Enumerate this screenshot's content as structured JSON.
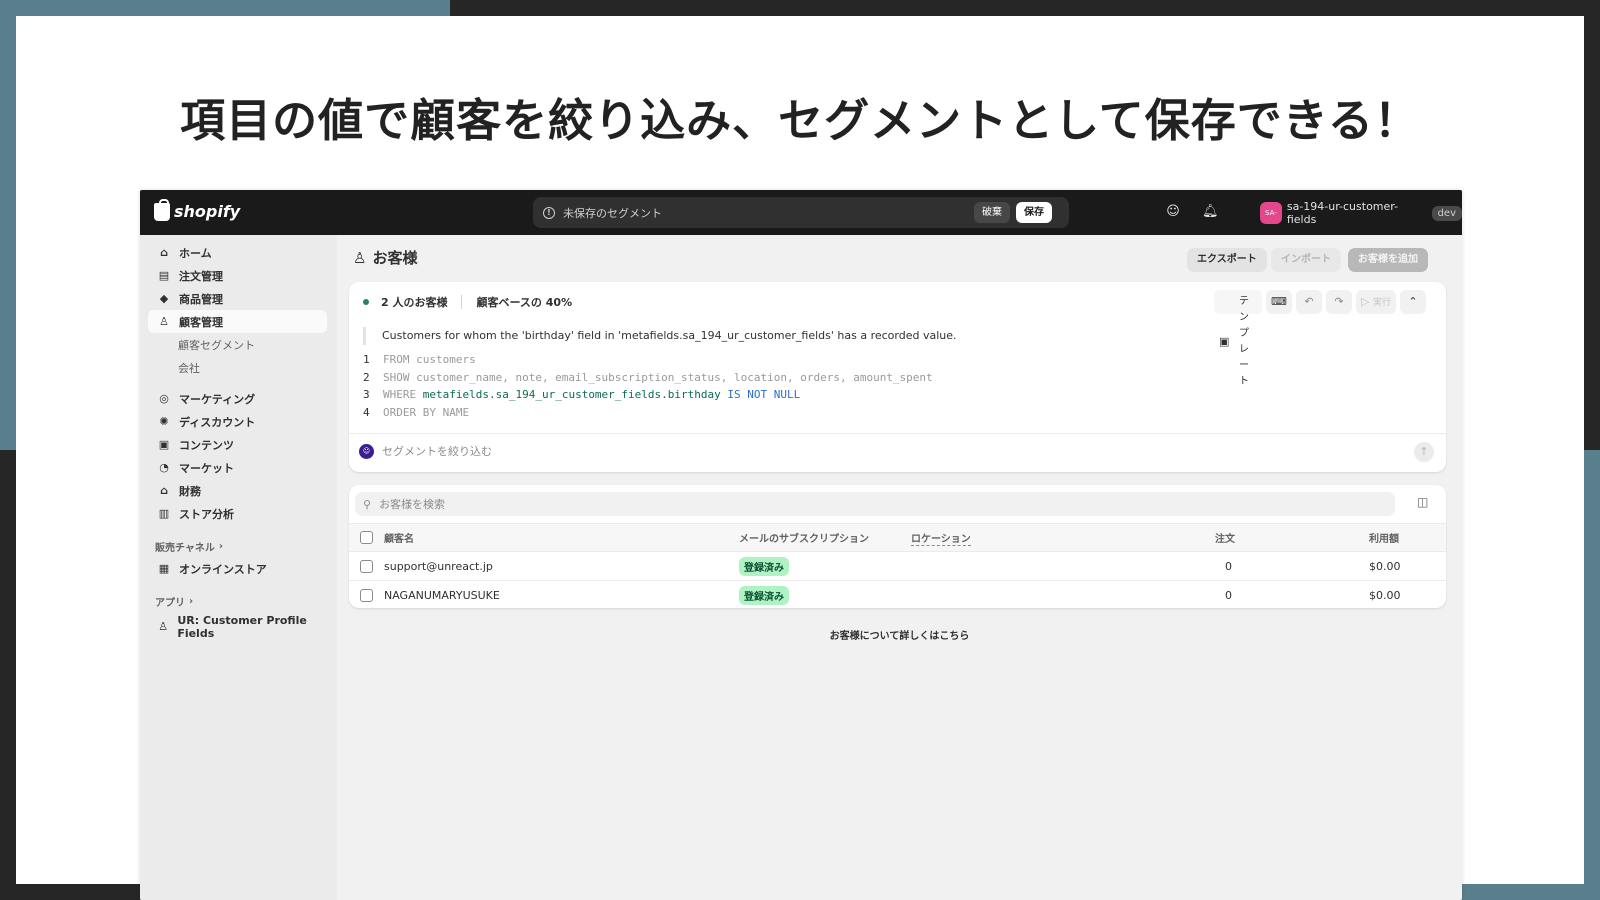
{
  "headline": "項目の値で顧客を絞り込み、セグメントとして保存できる！",
  "topbar": {
    "logo_text": "shopify",
    "search_text": "未保存のセグメント",
    "discard_label": "破棄",
    "save_label": "保存",
    "store_avatar": "SA-",
    "store_name": "sa-194-ur-customer-fields",
    "store_badge": "dev"
  },
  "sidebar": {
    "items": [
      {
        "label": "ホーム",
        "icon": "home-icon"
      },
      {
        "label": "注文管理",
        "icon": "inbox-icon"
      },
      {
        "label": "商品管理",
        "icon": "tag-icon"
      },
      {
        "label": "顧客管理",
        "icon": "person-icon"
      }
    ],
    "sub_items": [
      "顧客セグメント",
      "会社"
    ],
    "items2": [
      {
        "label": "マーケティング",
        "icon": "target-icon"
      },
      {
        "label": "ディスカウント",
        "icon": "discount-icon"
      },
      {
        "label": "コンテンツ",
        "icon": "content-icon"
      },
      {
        "label": "マーケット",
        "icon": "globe-icon"
      },
      {
        "label": "財務",
        "icon": "bank-icon"
      },
      {
        "label": "ストア分析",
        "icon": "chart-icon"
      }
    ],
    "sales_channels_label": "販売チャネル",
    "online_store_label": "オンラインストア",
    "apps_label": "アプリ",
    "app_item_label": "UR: Customer Profile Fields"
  },
  "page": {
    "title": "お客様",
    "export_label": "エクスポート",
    "import_label": "インポート",
    "add_label": "お客様を追加"
  },
  "editor": {
    "count_text": "2 人のお客様",
    "base_text": "顧客ベースの 40%",
    "template_label": "テンプレート",
    "run_label": "実行",
    "description": "Customers for whom the 'birthday' field in 'metafields.sa_194_ur_customer_fields' has a recorded value.",
    "code": {
      "l1_num": "1",
      "l1": "FROM customers",
      "l2_num": "2",
      "l2": "SHOW customer_name, note, email_subscription_status, location, orders, amount_spent",
      "l3_num": "3",
      "l3_kw": "WHERE",
      "l3_ident": "metafields.sa_194_ur_customer_fields.birthday",
      "l3_op": "IS NOT NULL",
      "l4_num": "4",
      "l4": "ORDER BY NAME"
    },
    "ai_placeholder": "セグメントを絞り込む"
  },
  "table": {
    "search_placeholder": "お客様を検索",
    "headers": {
      "name": "顧客名",
      "subscription": "メールのサブスクリプション",
      "location": "ロケーション",
      "orders": "注文",
      "amount": "利用額"
    },
    "rows": [
      {
        "name": "support@unreact.jp",
        "subscription": "登録済み",
        "location": "",
        "orders": "0",
        "amount": "$0.00"
      },
      {
        "name": "NAGANUMARYUSUKE",
        "subscription": "登録済み",
        "location": "",
        "orders": "0",
        "amount": "$0.00"
      }
    ]
  },
  "learn_more": "お客様について詳しくはこちら",
  "colors": {
    "accent_teal": "#5a7f8c",
    "topbar": "#1a1a1a",
    "badge_green": "#aff2c3",
    "avatar_pink": "#e5478c"
  }
}
